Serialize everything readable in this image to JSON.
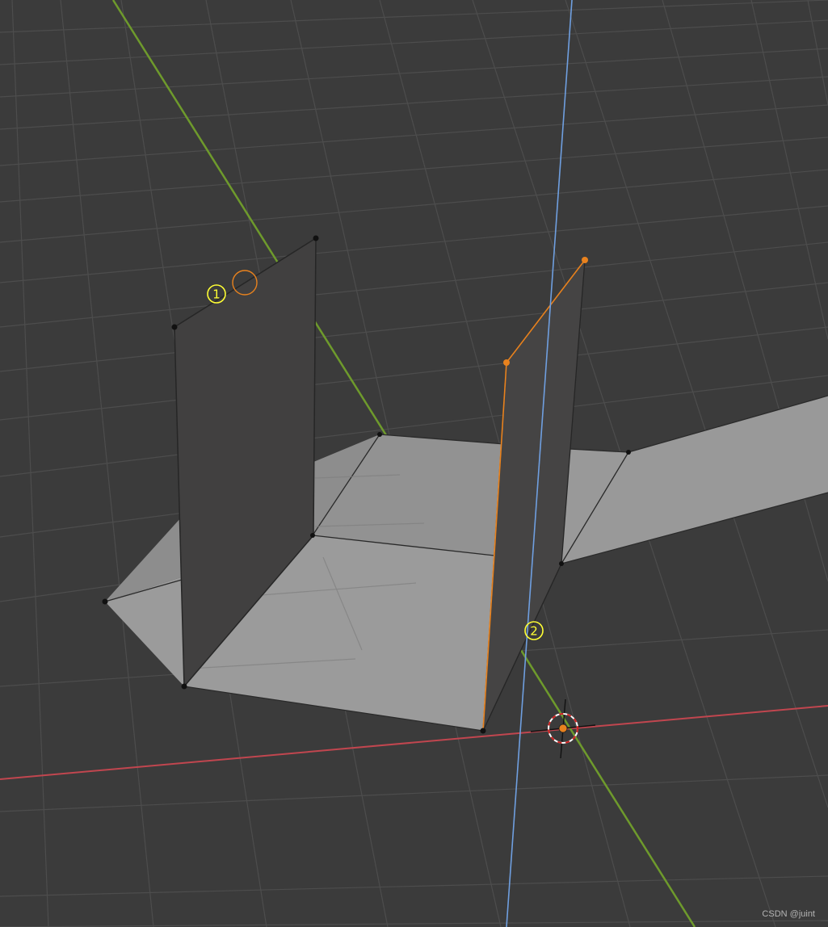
{
  "viewport": {
    "name": "blender-3d-viewport",
    "background_color": "#3b3b3b",
    "grid_color": "#4e4e4e",
    "axis_colors": {
      "x": "#c1464f",
      "y": "#6e9a2c",
      "z": "#6f9fe0"
    }
  },
  "mesh": {
    "face_light_color": "#9d9d9d",
    "face_dark_color": "#414040",
    "selected_edge_color": "#e8821e",
    "vertex_color": "#111111"
  },
  "annotations": [
    {
      "label": "1",
      "color": "#ffff33"
    },
    {
      "label": "2",
      "color": "#ffff33"
    }
  ],
  "cursor": {
    "name": "3d-cursor",
    "colors": [
      "#d0201f",
      "#ffffff"
    ]
  },
  "watermark": "CSDN @juint"
}
